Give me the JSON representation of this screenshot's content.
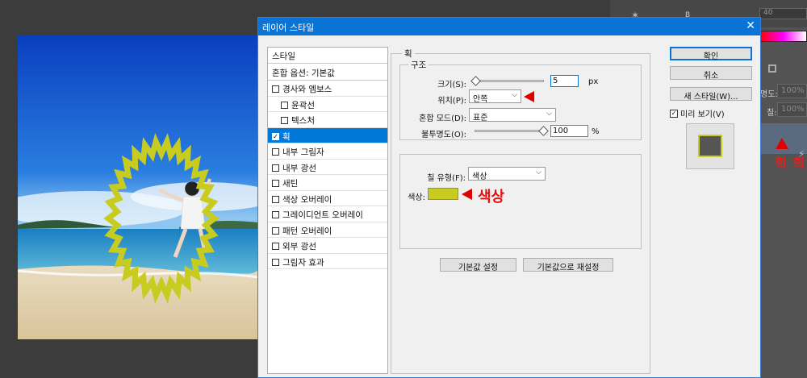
{
  "dialog": {
    "title": "레이어 스타일",
    "close_icon": "close-icon"
  },
  "style_list": {
    "header": "스타일",
    "blend_options": "혼합 옵션: 기본값",
    "items": [
      {
        "label": "경사와 엠보스",
        "checked": false,
        "sub": false
      },
      {
        "label": "윤곽선",
        "checked": false,
        "sub": true
      },
      {
        "label": "텍스처",
        "checked": false,
        "sub": true
      },
      {
        "label": "획",
        "checked": true,
        "sub": false,
        "selected": true
      },
      {
        "label": "내부 그림자",
        "checked": false,
        "sub": false
      },
      {
        "label": "내부 광선",
        "checked": false,
        "sub": false
      },
      {
        "label": "새틴",
        "checked": false,
        "sub": false
      },
      {
        "label": "색상 오버레이",
        "checked": false,
        "sub": false
      },
      {
        "label": "그레이디언트 오버레이",
        "checked": false,
        "sub": false
      },
      {
        "label": "패턴 오버레이",
        "checked": false,
        "sub": false
      },
      {
        "label": "외부 광선",
        "checked": false,
        "sub": false
      },
      {
        "label": "그림자 효과",
        "checked": false,
        "sub": false
      }
    ]
  },
  "stroke": {
    "section_title": "획",
    "structure_title": "구조",
    "size_label": "크기(S):",
    "size_value": "5",
    "size_unit": "px",
    "size_slider": 0.02,
    "position_label": "위치(P):",
    "position_value": "안쪽",
    "blend_mode_label": "혼합 모드(D):",
    "blend_mode_value": "표준",
    "opacity_label": "불투명도(O):",
    "opacity_value": "100",
    "opacity_unit": "%",
    "opacity_slider": 1.0,
    "fill_type_label": "칠 유형(F):",
    "fill_type_value": "색상",
    "color_label": "색상:",
    "color_value": "#c8cc20",
    "set_default_button": "기본값 설정",
    "reset_default_button": "기본값으로 재설정"
  },
  "buttons": {
    "ok": "확인",
    "cancel": "취소",
    "new_style": "새 스타일(W)...",
    "preview_label": "미리 보기(V)",
    "preview_checked": true
  },
  "annotations": {
    "color_note": "색상",
    "stroke_note": "획 획"
  },
  "right_panel": {
    "b_label": "B",
    "field_top": "40",
    "opacity_label": "명도:",
    "opacity_value": "100%",
    "fill_label": "칠:",
    "fill_value": "100%"
  },
  "colors": {
    "accent": "#0a74d6",
    "annotation_red": "#e00000",
    "stroke_color": "#c8cc20"
  }
}
